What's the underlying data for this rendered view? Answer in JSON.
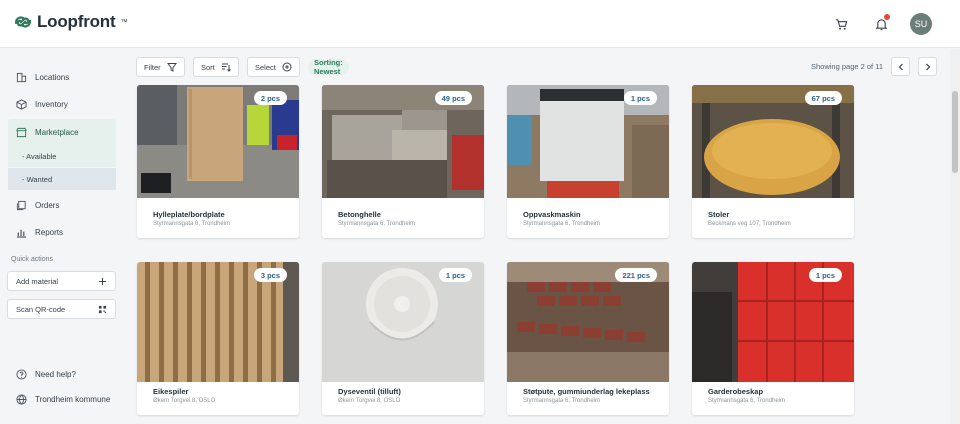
{
  "app": {
    "name": "Loopfront",
    "trademark": "™",
    "brand_color": "#2d7a5c"
  },
  "header": {
    "cart_icon": "cart-icon",
    "bell_icon": "bell-icon",
    "avatar_initials": "SU"
  },
  "sidebar": {
    "items": [
      {
        "label": "Locations",
        "icon": "building-icon"
      },
      {
        "label": "Inventory",
        "icon": "box-icon"
      },
      {
        "label": "Marketplace",
        "icon": "store-icon",
        "active": true
      },
      {
        "label": "Orders",
        "icon": "orders-icon"
      },
      {
        "label": "Reports",
        "icon": "chart-icon"
      }
    ],
    "marketplace_sub": [
      {
        "label": "- Available"
      },
      {
        "label": "- Wanted",
        "selected": true
      }
    ],
    "quick_actions_title": "Quick actions",
    "quick_actions": [
      {
        "label": "Add material",
        "icon": "plus-icon"
      },
      {
        "label": "Scan QR-code",
        "icon": "qr-icon"
      }
    ],
    "help_label": "Need help?",
    "org_label": "Trondheim kommune"
  },
  "toolbar": {
    "filter_label": "Filter",
    "sort_label": "Sort",
    "select_label": "Select",
    "sorting_label": "Sorting: Newest"
  },
  "pagination": {
    "text": "Showing page 2 of 11",
    "current_page": 2,
    "total_pages": 11
  },
  "cards": [
    {
      "title": "Hylleplate/bordplate",
      "address": "Styrmannsgata 6, Trondheim",
      "quantity": "2 pcs"
    },
    {
      "title": "Betonghelle",
      "address": "Styrmannsgata 6, Trondheim",
      "quantity": "49 pcs"
    },
    {
      "title": "Oppvaskmaskin",
      "address": "Styrmannsgata 6, Trondheim",
      "quantity": "1 pcs"
    },
    {
      "title": "Stoler",
      "address": "Beckmans veg 107, Trondheim",
      "quantity": "67 pcs"
    },
    {
      "title": "Eikespiler",
      "address": "Økern Torgvei 8, OSLO",
      "quantity": "3 pcs"
    },
    {
      "title": "Dyseventil (tilluft)",
      "address": "Økern Torgvei 8, OSLO",
      "quantity": "1 pcs"
    },
    {
      "title": "Støtpute, gummiunderlag lekeplass",
      "address": "Styrmannsgata 6, Trondheim",
      "quantity": "221 pcs"
    },
    {
      "title": "Garderobeskap",
      "address": "Styrmannsgata 6, Trondheim",
      "quantity": "1 pcs"
    }
  ]
}
